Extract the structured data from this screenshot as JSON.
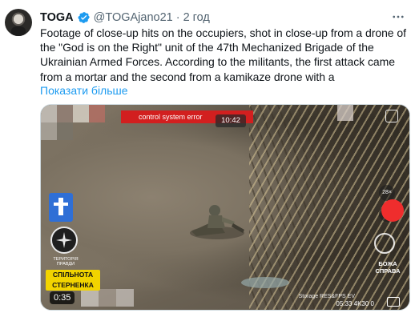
{
  "author": {
    "name": "TOGA",
    "handle": "@TOGAjano21",
    "separator": "·",
    "time": "2 год"
  },
  "tweet": {
    "text": "Footage of close-up hits on the occupiers, shot in close-up from a drone of the \"God is on the Right\" unit of the 47th Mechanized Brigade of the Ukrainian Armed Forces. According to the militants, the first attack came from a mortar and the second from a kamikaze drone with a",
    "show_more": "Показати більше"
  },
  "video": {
    "error_text": "control system error",
    "clock": "10:42",
    "duration": "0:35",
    "badge_text_line1": "СПІЛЬНОТА",
    "badge_text_line2": "СТЕРНЕНКА",
    "logo_caption": "ТЕРИТОРІЯ ПРАВДИ",
    "zoom_label": "28×",
    "af_label": "AF",
    "bozha_line1": "БОЖА",
    "bozha_line2": "СПРАВА",
    "storage_text": "Storage  RES&FPS  EV",
    "readout": "05:33   4K30   0"
  },
  "icons": {
    "verified": "verified-badge-icon",
    "more": "more-icon"
  },
  "colors": {
    "link": "#1d9bf0",
    "verified": "#1d9bf0",
    "record": "#ef2d2d",
    "badge": "#f2d400"
  }
}
